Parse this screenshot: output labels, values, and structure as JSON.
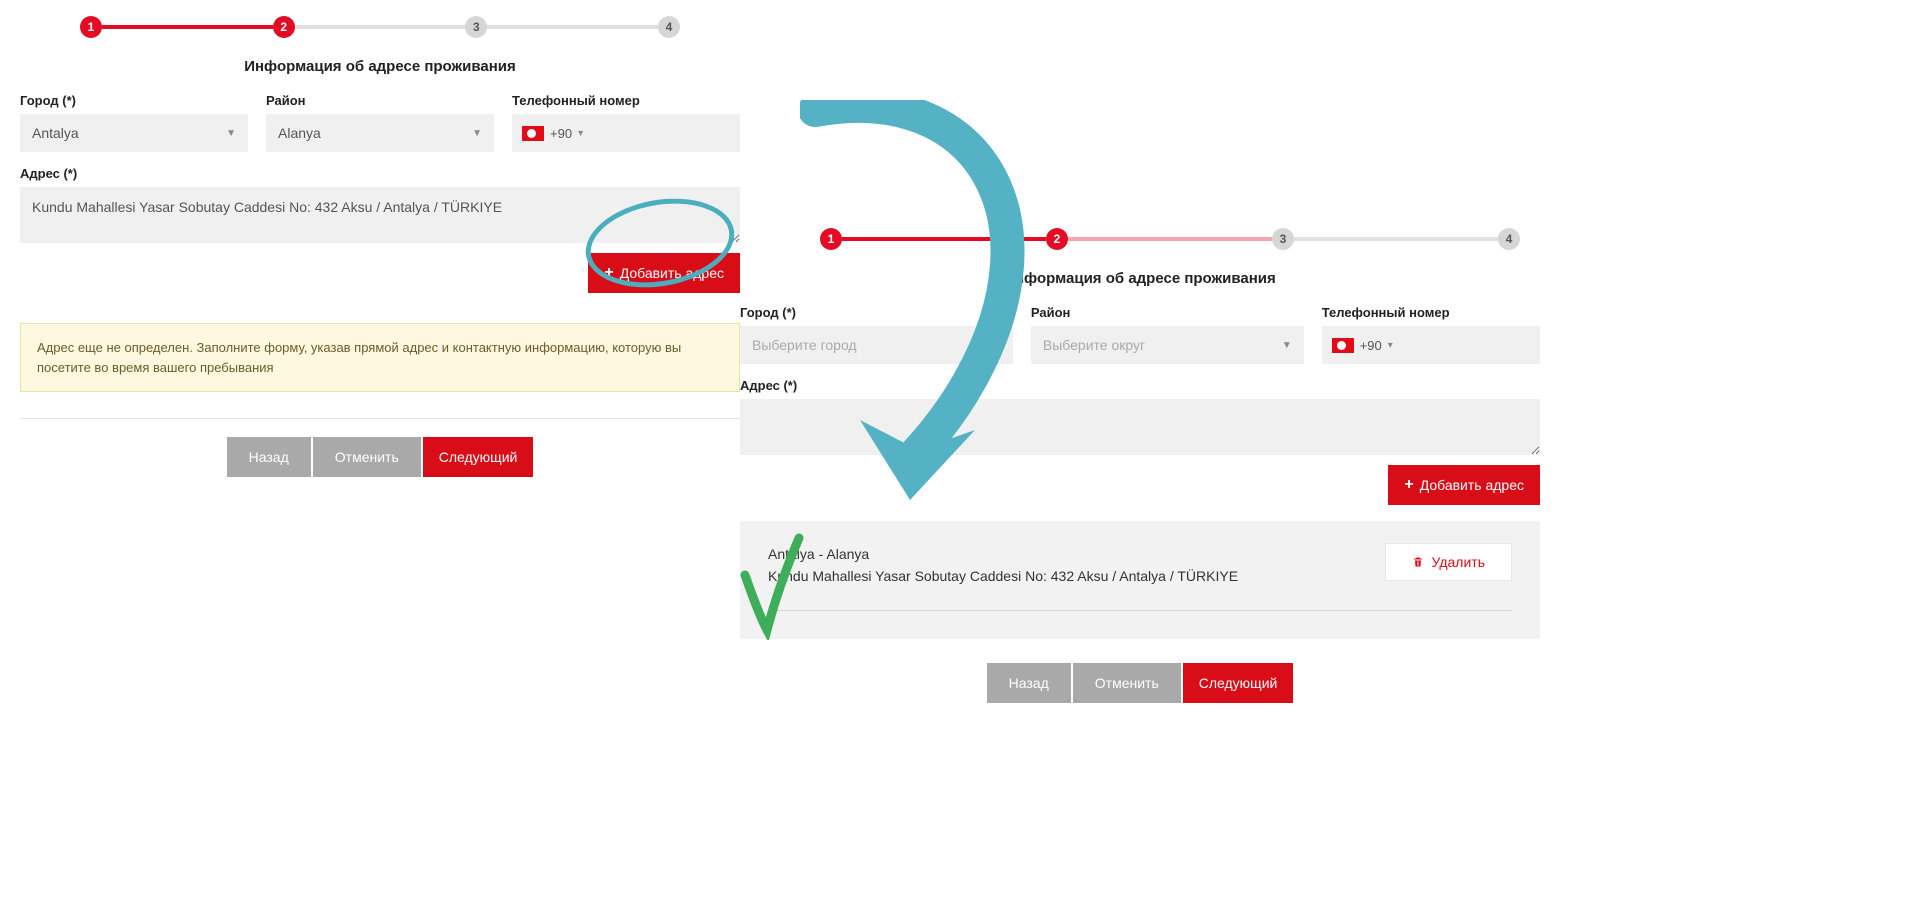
{
  "steps": {
    "s1": "1",
    "s2": "2",
    "s3": "3",
    "s4": "4"
  },
  "section_title": "Информация об адресе проживания",
  "labels": {
    "city": "Город (*)",
    "district": "Район",
    "phone": "Телефонный номер",
    "address": "Адрес (*)"
  },
  "left": {
    "city_value": "Antalya",
    "district_value": "Alanya",
    "phone_prefix": "+90",
    "address_value": "Kundu Mahallesi Yasar Sobutay Caddesi No: 432 Aksu / Antalya / TÜRKIYE"
  },
  "right": {
    "city_placeholder": "Выберите город",
    "district_placeholder": "Выберите округ",
    "phone_prefix": "+90"
  },
  "buttons": {
    "add_address": "Добавить адрес",
    "back": "Назад",
    "cancel": "Отменить",
    "next": "Следующий",
    "delete": "Удалить"
  },
  "alert_text": "Адрес еще не определен. Заполните форму, указав прямой адрес и контактную информацию, которую вы посетите во время вашего пребывания",
  "saved_address": {
    "header": "Antalya - Alanya",
    "line": "Kundu Mahallesi Yasar Sobutay Caddesi No: 432 Aksu / Antalya / TÜRKIYE"
  }
}
